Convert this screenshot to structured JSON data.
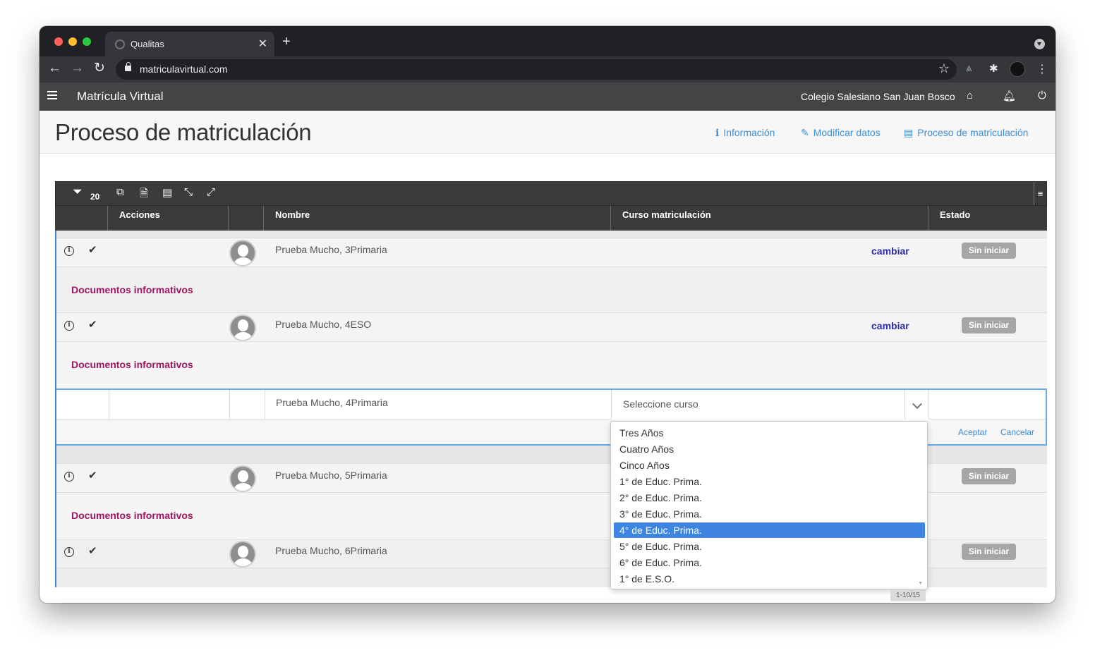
{
  "browser": {
    "tab_title": "Qualitas",
    "tab_close": "✕",
    "new_tab": "+",
    "url": "matriculavirtual.com"
  },
  "app": {
    "title": "Matrícula Virtual",
    "school": "Colegio Salesiano San Juan Bosco"
  },
  "page": {
    "title": "Proceso de matriculación",
    "links": [
      {
        "label": "Información",
        "icon": "info-icon"
      },
      {
        "label": "Modificar datos",
        "icon": "edit-icon"
      },
      {
        "label": "Proceso de matriculación",
        "icon": "id-card-icon"
      }
    ]
  },
  "grid": {
    "filter_count": "20",
    "columns": [
      "",
      "Acciones",
      "",
      "Nombre",
      "Curso matriculación",
      "Estado"
    ],
    "rows": [
      {
        "name": "Prueba Mucho, 3Primaria",
        "action": "cambiar",
        "status": "Sin iniciar",
        "docs": "Documentos informativos"
      },
      {
        "name": "Prueba Mucho, 4ESO",
        "action": "cambiar",
        "status": "Sin iniciar",
        "docs": "Documentos informativos"
      },
      {
        "name": "Prueba Mucho, 5Primaria",
        "action": "",
        "status": "Sin iniciar",
        "docs": "Documentos informativos"
      },
      {
        "name": "Prueba Mucho, 6Primaria",
        "action": "",
        "status": "Sin iniciar",
        "docs": ""
      }
    ],
    "edit_row": {
      "name": "Prueba Mucho, 4Primaria",
      "select_placeholder": "Seleccione curso",
      "accept": "Aceptar",
      "cancel": "Cancelar"
    },
    "dropdown_options": [
      "Tres Años",
      "Cuatro Años",
      "Cinco Años",
      "1° de Educ. Prima.",
      "2° de Educ. Prima.",
      "3° de Educ. Prima.",
      "4° de Educ. Prima.",
      "5° de Educ. Prima.",
      "6° de Educ. Prima.",
      "1° de E.S.O."
    ],
    "dropdown_selected": "4° de Educ. Prima.",
    "pager": "1-10/15"
  },
  "colors": {
    "app_bar": "#444444",
    "link_blue": "#3a8fd6",
    "docs_magenta": "#9c1760",
    "cambiar_blue": "#2c2ca8",
    "badge_gray": "#a6a6a6",
    "selected_blue": "#3d85e0"
  }
}
